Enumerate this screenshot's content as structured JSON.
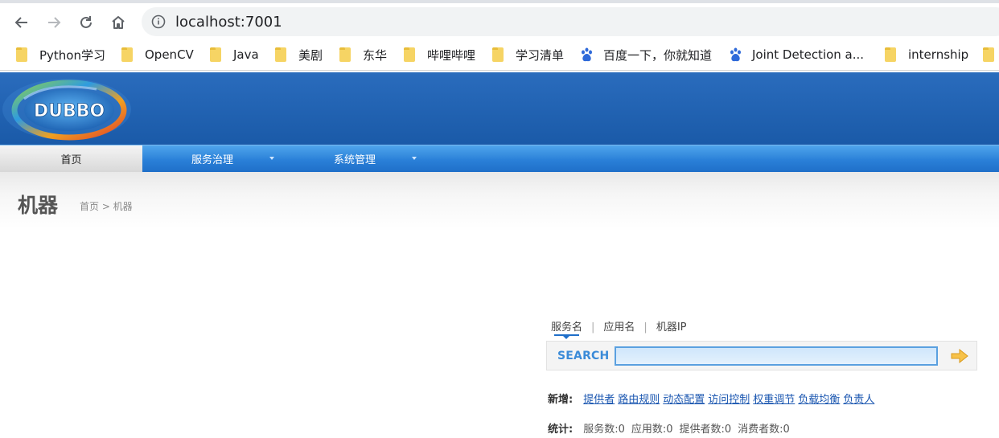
{
  "browser": {
    "url": "localhost:7001",
    "bookmarks": [
      {
        "label": "Python学习",
        "icon": "folder-icon"
      },
      {
        "label": "OpenCV",
        "icon": "folder-icon"
      },
      {
        "label": "Java",
        "icon": "folder-icon"
      },
      {
        "label": "美剧",
        "icon": "folder-icon"
      },
      {
        "label": "东华",
        "icon": "folder-icon"
      },
      {
        "label": "哔哩哔哩",
        "icon": "folder-icon"
      },
      {
        "label": "学习清单",
        "icon": "folder-icon"
      },
      {
        "label": "百度一下，你就知道",
        "icon": "baidu-icon"
      },
      {
        "label": "Joint Detection a...",
        "icon": "baidu-icon"
      },
      {
        "label": "internship",
        "icon": "folder-icon"
      }
    ]
  },
  "header": {
    "logo_text": "DUBBO"
  },
  "menu": {
    "home": "首页",
    "service_governance": "服务治理",
    "system_admin": "系统管理"
  },
  "page": {
    "title": "机器",
    "breadcrumb": "首页 > 机器"
  },
  "search": {
    "tabs": [
      "服务名",
      "应用名",
      "机器IP"
    ],
    "separator": "|",
    "label": "SEARCH",
    "value": ""
  },
  "add": {
    "label": "新增:",
    "links": [
      "提供者",
      "路由规则",
      "动态配置",
      "访问控制",
      "权重调节",
      "负载均衡",
      "负责人"
    ]
  },
  "stats": {
    "label": "统计:",
    "items": [
      "服务数:0",
      "应用数:0",
      "提供者数:0",
      "消费者数:0"
    ]
  },
  "colors": {
    "header_blue": "#1f61ad",
    "menu_blue": "#2a80d8",
    "link_blue": "#1a56b0",
    "search_label": "#3b8bd8"
  }
}
